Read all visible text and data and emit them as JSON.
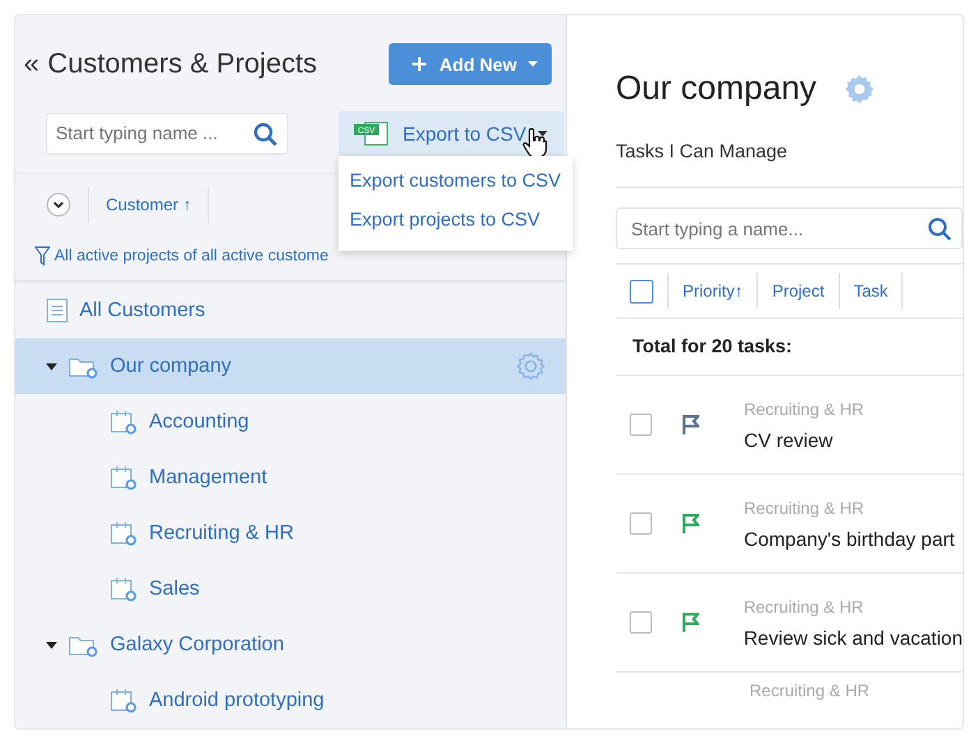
{
  "sidebar": {
    "title": "Customers & Projects",
    "collapse_glyph": "«",
    "add_button": "Add New",
    "search": {
      "placeholder": "Start typing name ..."
    },
    "export_button": "Export to CSV",
    "csv_icon_text": "CSV",
    "export_menu": {
      "items": [
        "Export customers to CSV",
        "Export projects to CSV"
      ]
    },
    "column": "Customer",
    "sort_glyph": "↑",
    "filter": "All active projects of all active custome",
    "all_item": "All Customers",
    "tree": [
      {
        "label": "Our company",
        "selected": true,
        "expanded": true,
        "children": [
          {
            "label": "Accounting",
            "selected": false
          },
          {
            "label": "Management",
            "selected": false
          },
          {
            "label": "Recruiting & HR",
            "selected": false
          },
          {
            "label": "Sales",
            "selected": false
          }
        ]
      },
      {
        "label": "Galaxy Corporation",
        "selected": false,
        "expanded": true,
        "children": [
          {
            "label": "Android prototyping",
            "selected": false
          }
        ]
      }
    ]
  },
  "main": {
    "title": "Our company",
    "subtitle": "Tasks I Can Manage",
    "search": {
      "placeholder": "Start typing a name..."
    },
    "select_all_checked": false,
    "columns": [
      "Priority",
      "Project",
      "Task"
    ],
    "sort_glyph": "↑",
    "total": "Total for 20 tasks:",
    "tasks": [
      {
        "project": "Recruiting & HR",
        "name": "CV review",
        "checked": false,
        "color": "#5a7190"
      },
      {
        "project": "Recruiting & HR",
        "name": "Company's birthday part",
        "checked": false,
        "color": "#2eaa5c"
      },
      {
        "project": "Recruiting & HR",
        "name": "Review sick and vacation",
        "checked": false,
        "color": "#2eaa5c"
      }
    ],
    "partial_task": {
      "project": "Recruiting & HR"
    }
  }
}
